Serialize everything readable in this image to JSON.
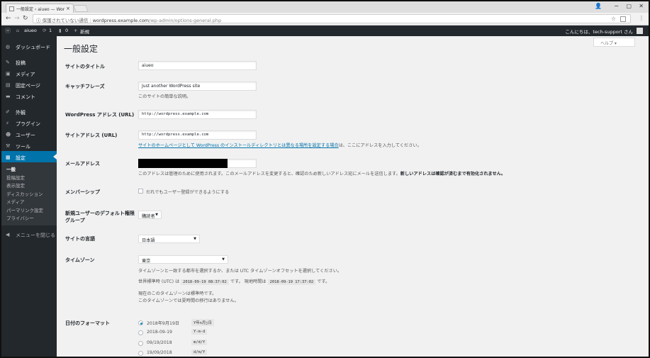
{
  "browser": {
    "tab_title": "一般設定 ‹ aiueo — Wor",
    "tab_close": "×",
    "security_label": "保護されていない通信",
    "url_host": "wordpress.example.com",
    "url_path": "/wp-admin/options-general.php",
    "window_controls": [
      "−",
      "▢",
      "✕"
    ]
  },
  "adminbar": {
    "site_name": "aiueo",
    "updates_count": "1",
    "comments_count": "0",
    "new_label": "新規",
    "greeting": "こんにちは、tech-support さん"
  },
  "sidebar": {
    "items": [
      {
        "label": "ダッシュボード",
        "icon": "dashboard-icon"
      },
      {
        "label": "投稿",
        "icon": "pin-icon"
      },
      {
        "label": "メディア",
        "icon": "media-icon"
      },
      {
        "label": "固定ページ",
        "icon": "page-icon"
      },
      {
        "label": "コメント",
        "icon": "comment-icon"
      },
      {
        "label": "外観",
        "icon": "brush-icon"
      },
      {
        "label": "プラグイン",
        "icon": "plugin-icon"
      },
      {
        "label": "ユーザー",
        "icon": "user-icon"
      },
      {
        "label": "ツール",
        "icon": "wrench-icon"
      },
      {
        "label": "設定",
        "icon": "settings-icon"
      }
    ],
    "submenu": [
      "一般",
      "投稿設定",
      "表示設定",
      "ディスカッション",
      "メディア",
      "パーマリンク設定",
      "プライバシー"
    ],
    "collapse_label": "メニューを閉じる"
  },
  "main": {
    "help_label": "ヘルプ ▾",
    "page_title": "一般設定",
    "blogname_label": "サイトのタイトル",
    "blogname_value": "aiueo",
    "tagline_label": "キャッチフレーズ",
    "tagline_value": "Just another WordPress site",
    "tagline_desc": "このサイトの簡単な説明。",
    "wpurl_label": "WordPress アドレス (URL)",
    "wpurl_value": "http://wordpress.example.com",
    "siteurl_label": "サイトアドレス (URL)",
    "siteurl_value": "http://wordpress.example.com",
    "siteurl_desc_link": "サイトのホームページとして WordPress のインストールディレクトリとは異なる場所を設定する場合",
    "siteurl_desc_rest": "は、ここにアドレスを入力してください。",
    "email_label": "メールアドレス",
    "email_desc": "このアドレスは管理のために使用されます。このメールアドレスを変更すると、確認のため新しいアドレス宛にメールを送信します。",
    "email_desc_bold": "新しいアドレスは確認が済むまで有効化されません。",
    "membership_label": "メンバーシップ",
    "membership_checkbox": "だれでもユーザー登録ができるようにする",
    "role_label_1": "新規ユーザーのデフォルト権限",
    "role_label_2": "グループ",
    "role_value": "購読者",
    "lang_label": "サイトの言語",
    "lang_value": "日本語",
    "tz_label": "タイムゾーン",
    "tz_value": "東京",
    "tz_desc": "タイムゾーンと一致する都市を選択するか、または UTC タイムゾーンオフセットを選択してください。",
    "utc_prefix": "世界標準時 (UTC) は",
    "utc_time": "2018-09-19 08:37:02",
    "utc_suffix": "です。 現地時間は",
    "local_time": "2018-09-19 17:37:02",
    "local_suffix": "です。",
    "tz_note_1": "現在のこのタイムゾーンは標準時です。",
    "tz_note_2": "このタイムゾーンでは夏時間の移行はありません。",
    "date_label": "日付のフォーマット",
    "date_formats": [
      {
        "label": "2018年9月19日",
        "code": "Y年n月j日",
        "selected": true
      },
      {
        "label": "2018-09-19",
        "code": "Y-m-d",
        "selected": false
      },
      {
        "label": "09/19/2018",
        "code": "m/d/Y",
        "selected": false
      },
      {
        "label": "19/09/2018",
        "code": "d/m/Y",
        "selected": false
      }
    ]
  }
}
